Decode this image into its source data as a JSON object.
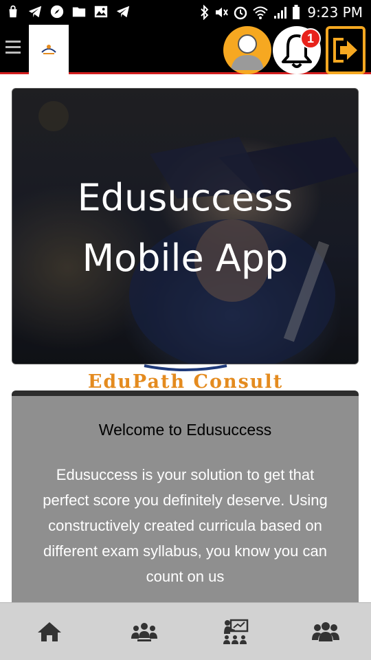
{
  "status_bar": {
    "time": "9:23 PM",
    "left_icons": [
      "bag-icon",
      "telegram-icon",
      "compass-icon",
      "folder-icon",
      "image-icon",
      "telegram-icon"
    ],
    "right_icons": [
      "bluetooth-icon",
      "mute-icon",
      "alarm-icon",
      "wifi-icon",
      "signal-icon",
      "battery-icon"
    ]
  },
  "header": {
    "menu_icon": "hamburger-icon",
    "notification_count": "1",
    "accent_color": "#f6a821",
    "underline_color": "#d41f1f"
  },
  "hero": {
    "title_line1": "Edusuccess",
    "title_line2": "Mobile App"
  },
  "brand": {
    "name": "EduPath Consult",
    "color": "#e48b1f"
  },
  "welcome": {
    "heading": "Welcome to Edusuccess",
    "body": "Edusuccess is your solution to get that perfect score you definitely deserve. Using constructively created curricula based on different exam syllabus, you know you can count on us"
  },
  "bottom_nav": {
    "items": [
      {
        "icon": "home-icon"
      },
      {
        "icon": "group-icon"
      },
      {
        "icon": "classroom-icon"
      },
      {
        "icon": "users-icon"
      }
    ]
  }
}
